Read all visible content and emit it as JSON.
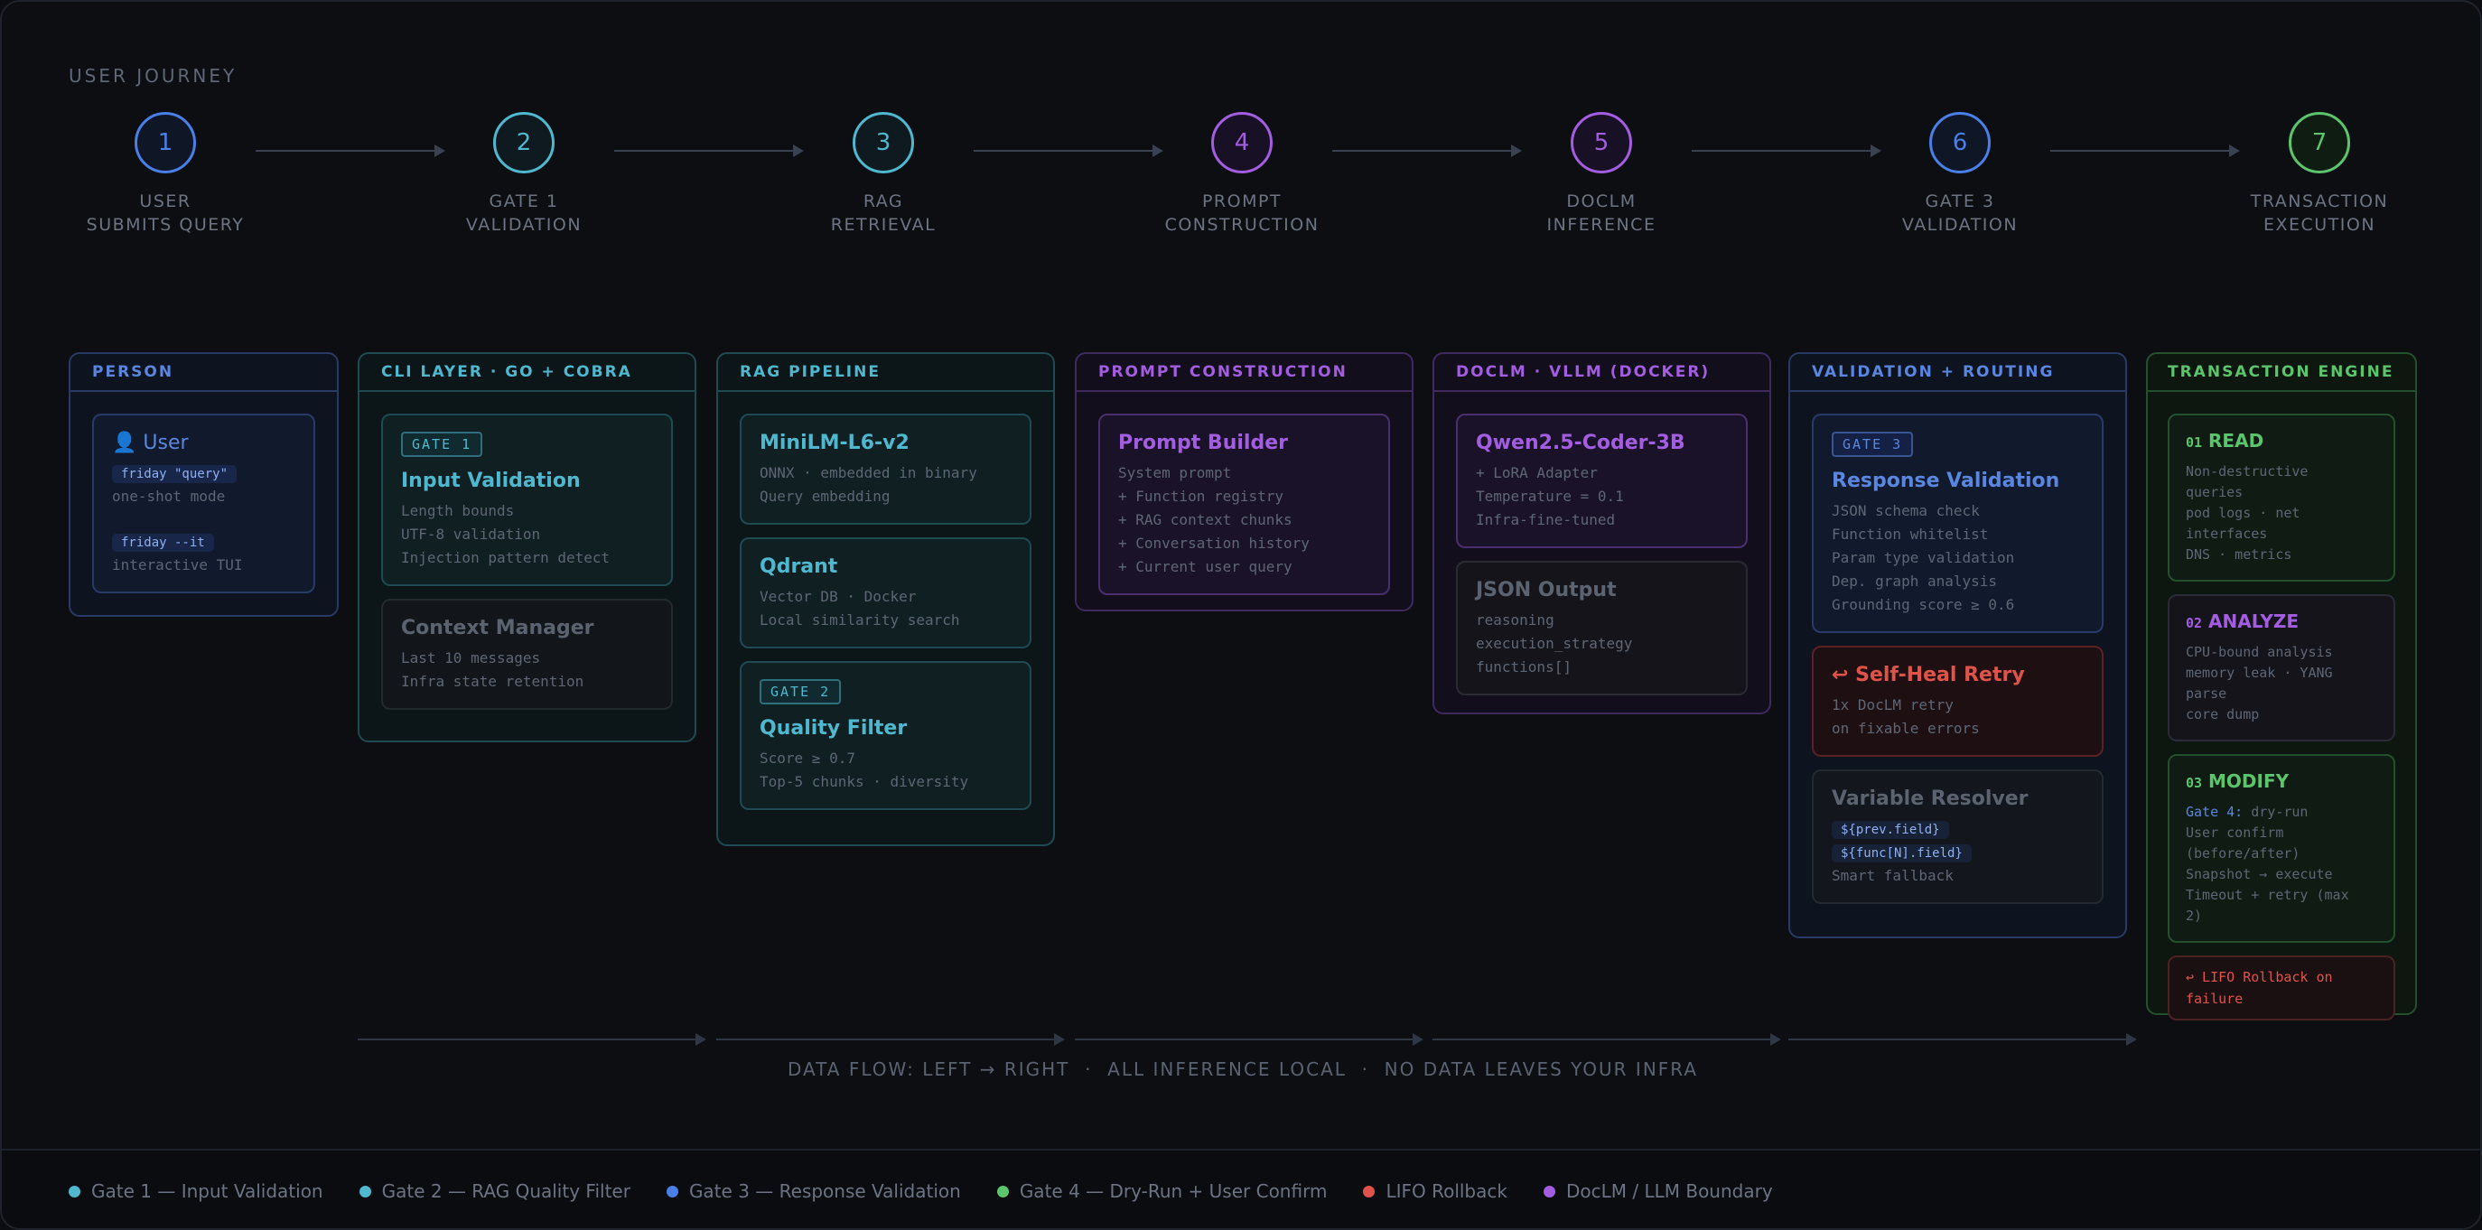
{
  "journey": {
    "title": "USER JOURNEY",
    "steps": [
      {
        "num": "1",
        "line1": "USER",
        "line2": "SUBMITS QUERY",
        "color": "#4a7fe6"
      },
      {
        "num": "2",
        "line1": "GATE 1",
        "line2": "VALIDATION",
        "color": "#4fb8cf"
      },
      {
        "num": "3",
        "line1": "RAG",
        "line2": "RETRIEVAL",
        "color": "#4fb8cf"
      },
      {
        "num": "4",
        "line1": "PROMPT",
        "line2": "CONSTRUCTION",
        "color": "#a35de0"
      },
      {
        "num": "5",
        "line1": "DOCLM",
        "line2": "INFERENCE",
        "color": "#a35de0"
      },
      {
        "num": "6",
        "line1": "GATE 3",
        "line2": "VALIDATION",
        "color": "#4a7fe6"
      },
      {
        "num": "7",
        "line1": "TRANSACTION",
        "line2": "EXECUTION",
        "color": "#5cc46c"
      }
    ]
  },
  "columns": {
    "person": {
      "title": "PERSON",
      "user": {
        "icon": "👤",
        "title": "User",
        "cmd1": "friday \"query\"",
        "desc1": "one-shot mode",
        "cmd2": "friday --it",
        "desc2": "interactive TUI"
      }
    },
    "cli": {
      "title": "CLI LAYER · GO + COBRA",
      "input": {
        "gate": "GATE 1",
        "title": "Input Validation",
        "lines": [
          "Length bounds",
          "UTF-8 validation",
          "Injection pattern detect"
        ]
      },
      "context": {
        "title": "Context Manager",
        "lines": [
          "Last 10 messages",
          "Infra state retention"
        ]
      }
    },
    "rag": {
      "title": "RAG PIPELINE",
      "minilm": {
        "title": "MiniLM-L6-v2",
        "lines": [
          "ONNX · embedded in binary",
          "Query embedding"
        ]
      },
      "qdrant": {
        "title": "Qdrant",
        "lines": [
          "Vector DB · Docker",
          "Local similarity search"
        ]
      },
      "quality": {
        "gate": "GATE 2",
        "title": "Quality Filter",
        "lines": [
          "Score ≥ 0.7",
          "Top-5 chunks · diversity"
        ]
      }
    },
    "prompt": {
      "title": "PROMPT CONSTRUCTION",
      "builder": {
        "title": "Prompt Builder",
        "lines": [
          "System prompt",
          "+ Function registry",
          "+ RAG context chunks",
          "+ Conversation history",
          "+ Current user query"
        ]
      }
    },
    "doclm": {
      "title": "DOCLM · VLLM (DOCKER)",
      "qwen": {
        "title": "Qwen2.5-Coder-3B",
        "lines": [
          "+ LoRA Adapter",
          "Temperature = 0.1",
          "Infra-fine-tuned"
        ]
      },
      "json": {
        "title": "JSON Output",
        "lines": [
          "reasoning",
          "execution_strategy",
          "functions[]"
        ]
      }
    },
    "validation": {
      "title": "VALIDATION + ROUTING",
      "response": {
        "gate": "GATE 3",
        "title": "Response Validation",
        "lines": [
          "JSON schema check",
          "Function whitelist",
          "Param type validation",
          "Dep. graph analysis",
          "Grounding score ≥ 0.6"
        ]
      },
      "heal": {
        "title": "↩ Self-Heal Retry",
        "lines": [
          "1x DocLM retry",
          "on fixable errors"
        ]
      },
      "resolver": {
        "title": "Variable Resolver",
        "chip1": "${prev.field}",
        "chip2": "${func[N].field}",
        "desc": "Smart fallback"
      }
    },
    "transaction": {
      "title": "TRANSACTION ENGINE",
      "read": {
        "num": "01",
        "title": "READ",
        "lines": [
          "Non-destructive",
          "queries",
          "pod logs · net",
          "interfaces",
          "DNS · metrics"
        ]
      },
      "analyze": {
        "num": "02",
        "title": "ANALYZE",
        "lines": [
          "CPU-bound analysis",
          "memory leak · YANG",
          "parse",
          "core dump"
        ]
      },
      "modify": {
        "num": "03",
        "title": "MODIFY",
        "gate_label": "Gate 4:",
        "gate_text": " dry-run",
        "lines": [
          "User confirm",
          "(before/after)",
          "Snapshot → execute",
          "Timeout + retry (max",
          "2)"
        ]
      },
      "rollback": {
        "line1": "↩ LIFO Rollback on",
        "line2": "failure"
      }
    }
  },
  "flow_caption": "DATA FLOW: LEFT → RIGHT  ·  ALL INFERENCE LOCAL  ·  NO DATA LEAVES YOUR INFRA",
  "legend": [
    {
      "label": "Gate 1 — Input Validation",
      "color": "#4fb8cf"
    },
    {
      "label": "Gate 2 — RAG Quality Filter",
      "color": "#4fb8cf"
    },
    {
      "label": "Gate 3 — Response Validation",
      "color": "#4a7fe6"
    },
    {
      "label": "Gate 4 — Dry-Run + User Confirm",
      "color": "#5cc46c"
    },
    {
      "label": "LIFO Rollback",
      "color": "#e0534a"
    },
    {
      "label": "DocLM / LLM Boundary",
      "color": "#a35de0"
    }
  ]
}
